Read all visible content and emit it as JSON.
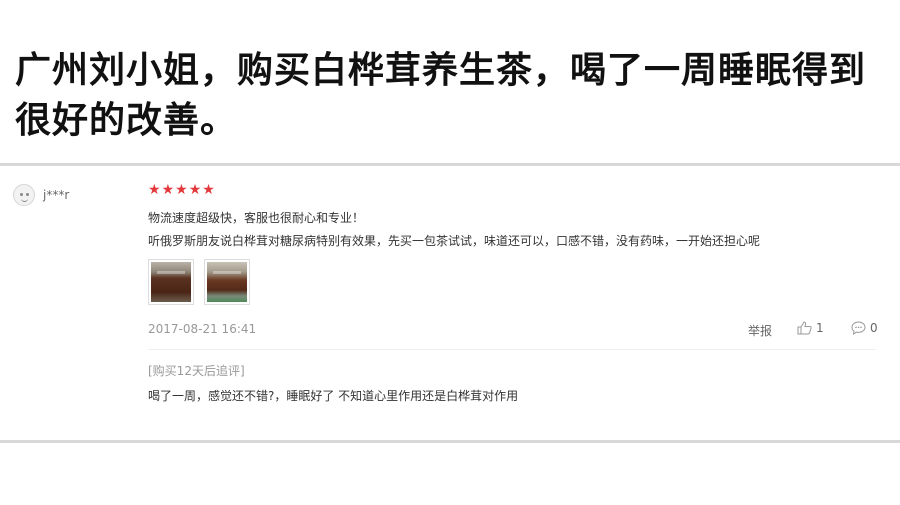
{
  "headline": "广州刘小姐，购买白桦茸养生茶，喝了一周睡眠得到很好的改善。",
  "review": {
    "username": "j***r",
    "rating": 5,
    "star_color": "#e4393c",
    "lines": [
      "物流速度超级快，客服也很耐心和专业！",
      "听俄罗斯朋友说白桦茸对糖尿病特别有效果，先买一包茶试试，味道还可以，口感不错，没有药味，一开始还担心呢"
    ],
    "images": [
      "tea-photo-1",
      "tea-photo-2"
    ],
    "datetime": "2017-08-21 16:41",
    "report_label": "举报",
    "like_count": "1",
    "comment_count": "0",
    "followup": {
      "tag": "[购买12天后追评]",
      "text": "喝了一周，感觉还不错?，睡眠好了 不知道心里作用还是白桦茸对作用"
    }
  }
}
